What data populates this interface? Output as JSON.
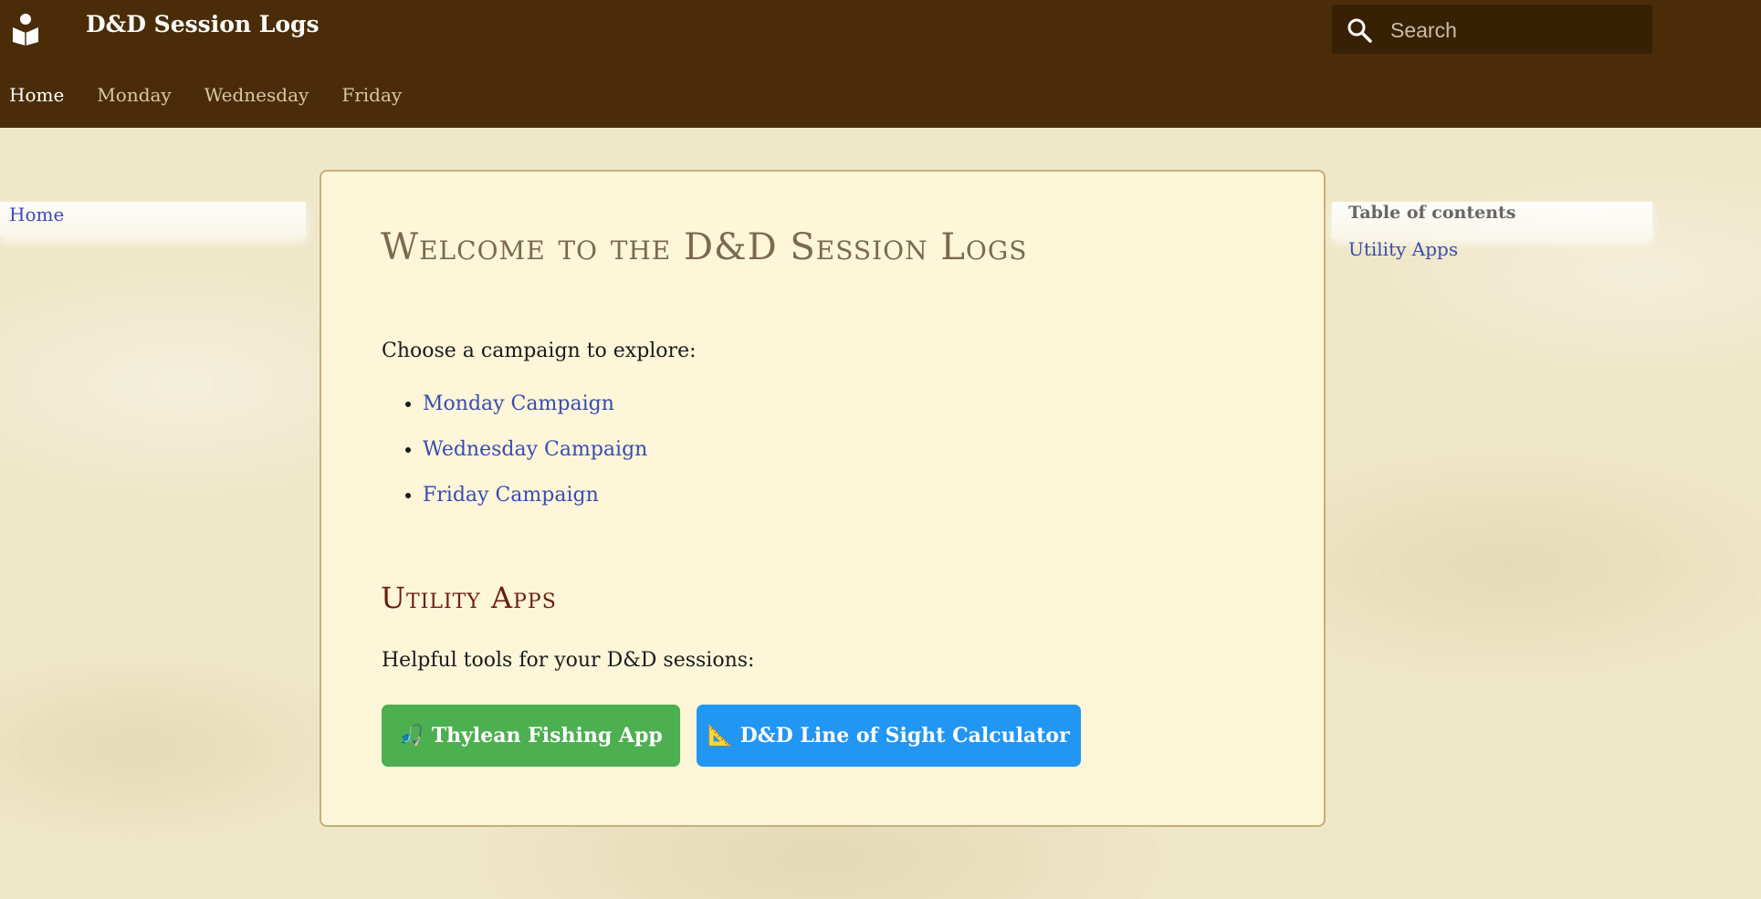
{
  "header": {
    "site_title": "D&D Session Logs",
    "logo_icon": "book-reader-icon",
    "search": {
      "placeholder": "Search",
      "value": ""
    },
    "nav": [
      {
        "label": "Home",
        "active": true
      },
      {
        "label": "Monday",
        "active": false
      },
      {
        "label": "Wednesday",
        "active": false
      },
      {
        "label": "Friday",
        "active": false
      }
    ]
  },
  "left_sidebar": {
    "items": [
      {
        "label": "Home"
      }
    ]
  },
  "main": {
    "title": "Welcome to the D&D Session Logs",
    "intro": "Choose a campaign to explore:",
    "campaigns": [
      {
        "label": "Monday Campaign"
      },
      {
        "label": "Wednesday Campaign"
      },
      {
        "label": "Friday Campaign"
      }
    ],
    "utility_heading": "Utility Apps",
    "utility_intro": "Helpful tools for your D&D sessions:",
    "buttons": [
      {
        "glyph": "🎣",
        "label": "Thylean Fishing App",
        "color": "#4caf50"
      },
      {
        "glyph": "📐",
        "label": "D&D Line of Sight Calculator",
        "color": "#2196f3"
      }
    ]
  },
  "toc": {
    "title": "Table of contents",
    "items": [
      {
        "label": "Utility Apps"
      }
    ]
  },
  "colors": {
    "header_bg": "#4a2d08",
    "link": "#3a4bb0",
    "card_bg": "#fdf6d9",
    "heading_red": "#6b1e0f"
  }
}
